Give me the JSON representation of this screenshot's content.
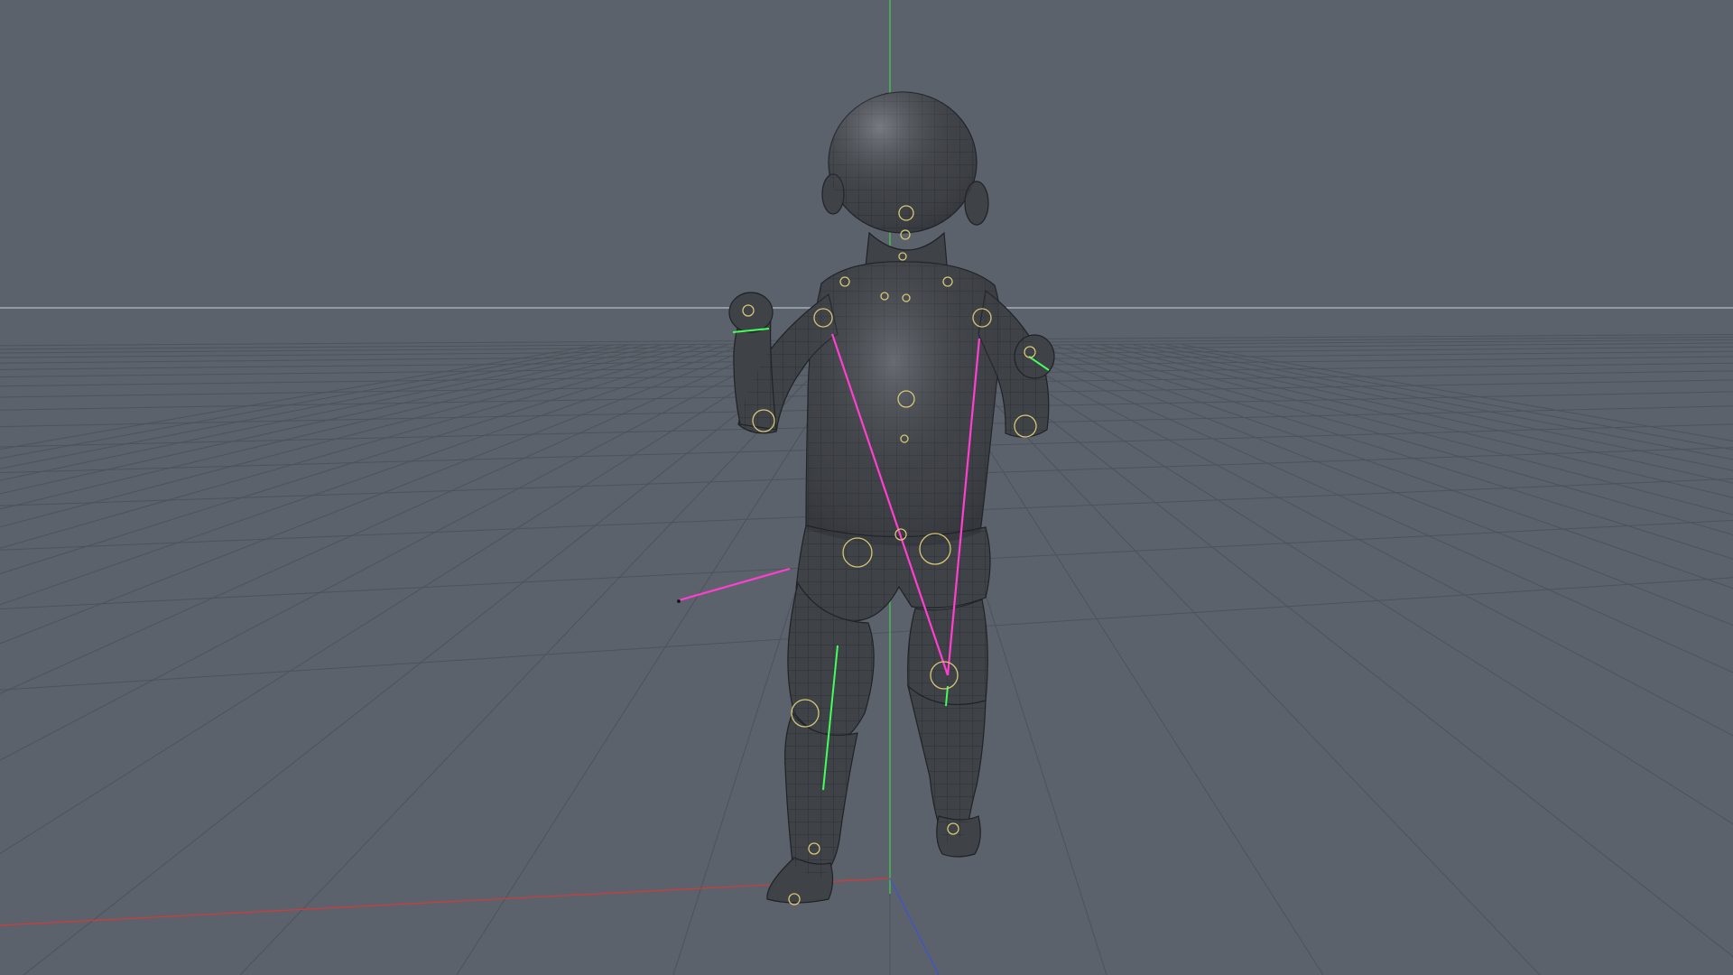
{
  "viewport": {
    "background": "#5b626b",
    "grid_line_color": "#4d535b",
    "horizon_line_color": "#b7bcc2",
    "axis_colors": {
      "x": "#d43a3a",
      "y": "#3fd14a",
      "z": "#3c53d6"
    }
  },
  "model": {
    "mesh_fill": "#3f4247",
    "wire_color": "#1f2226",
    "highlight_color": "#8a8f96",
    "joint_color": "#d8c774"
  },
  "rig": {
    "ik_line_color": "#ff3fd0",
    "bone_line_color": "#42ff5a"
  },
  "icons": [
    "perspective-grid",
    "world-axis-gizmo",
    "character-mesh",
    "joint-markers"
  ]
}
